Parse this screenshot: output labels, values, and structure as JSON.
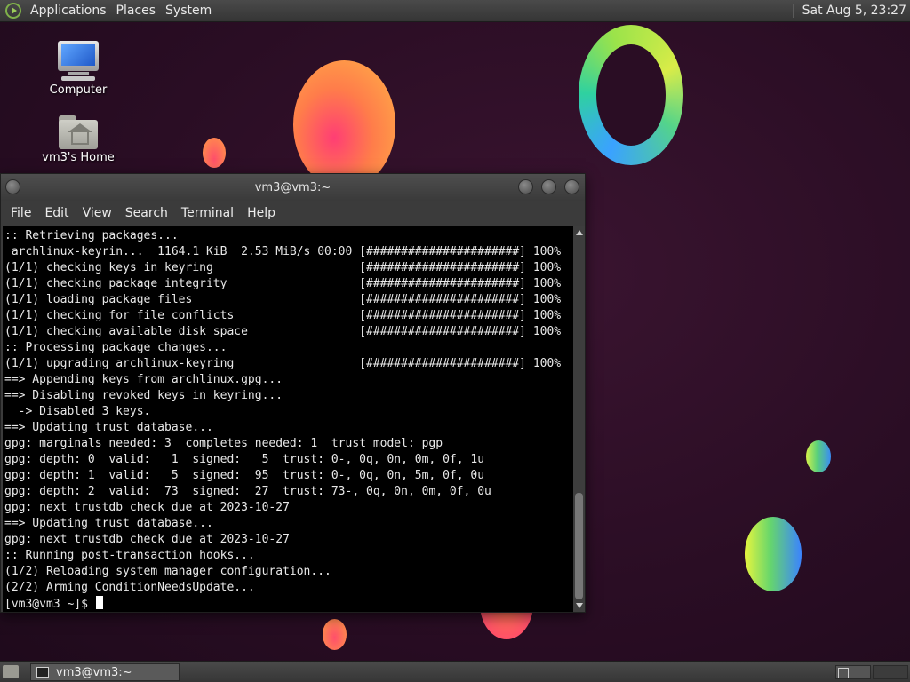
{
  "top_panel": {
    "menus": [
      "Applications",
      "Places",
      "System"
    ],
    "clock": "Sat Aug  5, 23:27"
  },
  "desktop": {
    "icons": [
      {
        "label": "Computer",
        "icon": "computer-icon"
      },
      {
        "label": "vm3's Home",
        "icon": "home-folder-icon"
      }
    ]
  },
  "terminal": {
    "title": "vm3@vm3:~",
    "menus": [
      "File",
      "Edit",
      "View",
      "Search",
      "Terminal",
      "Help"
    ],
    "lines": [
      ":: Retrieving packages...",
      " archlinux-keyrin...  1164.1 KiB  2.53 MiB/s 00:00 [######################] 100%",
      "(1/1) checking keys in keyring                     [######################] 100%",
      "(1/1) checking package integrity                   [######################] 100%",
      "(1/1) loading package files                        [######################] 100%",
      "(1/1) checking for file conflicts                  [######################] 100%",
      "(1/1) checking available disk space                [######################] 100%",
      ":: Processing package changes...",
      "(1/1) upgrading archlinux-keyring                  [######################] 100%",
      "==> Appending keys from archlinux.gpg...",
      "==> Disabling revoked keys in keyring...",
      "  -> Disabled 3 keys.",
      "==> Updating trust database...",
      "gpg: marginals needed: 3  completes needed: 1  trust model: pgp",
      "gpg: depth: 0  valid:   1  signed:   5  trust: 0-, 0q, 0n, 0m, 0f, 1u",
      "gpg: depth: 1  valid:   5  signed:  95  trust: 0-, 0q, 0n, 5m, 0f, 0u",
      "gpg: depth: 2  valid:  73  signed:  27  trust: 73-, 0q, 0n, 0m, 0f, 0u",
      "gpg: next trustdb check due at 2023-10-27",
      "==> Updating trust database...",
      "gpg: next trustdb check due at 2023-10-27",
      ":: Running post-transaction hooks...",
      "(1/2) Reloading system manager configuration...",
      "(2/2) Arming ConditionNeedsUpdate..."
    ],
    "prompt": "[vm3@vm3 ~]$ "
  },
  "taskbar": {
    "task_label": "vm3@vm3:~"
  }
}
